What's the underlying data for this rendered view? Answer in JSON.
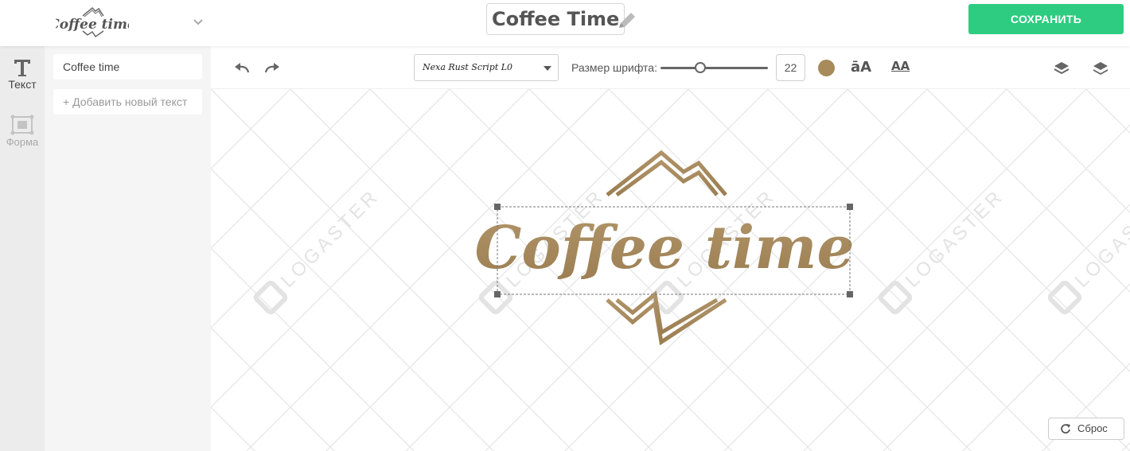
{
  "header": {
    "logo_text": "Coffee time",
    "title": "Coffee Time",
    "save_label": "СОХРАНИТЬ"
  },
  "sidebar": {
    "items": [
      {
        "label": "Текст",
        "icon": "text-icon",
        "active": true
      },
      {
        "label": "Форма",
        "icon": "shape-icon",
        "active": false
      }
    ]
  },
  "text_panel": {
    "text_value": "Coffee time",
    "add_label": "+ Добавить новый текст"
  },
  "toolbar": {
    "font_name": "Nexa Rust Script L0",
    "size_label": "Размер шрифта:",
    "font_size": "22",
    "slider_level": 0.37,
    "text_color": "#a88b5b",
    "case_icon_label": "āA",
    "spacing_icon_label": "AA"
  },
  "canvas": {
    "logo_text": "Coffee time",
    "watermark": "LOGASTER",
    "reset_label": "Сброс"
  },
  "colors": {
    "accent": "#2ecc80",
    "logo_gold": "#a88b5b",
    "sidebar_bg": "#ececec"
  }
}
